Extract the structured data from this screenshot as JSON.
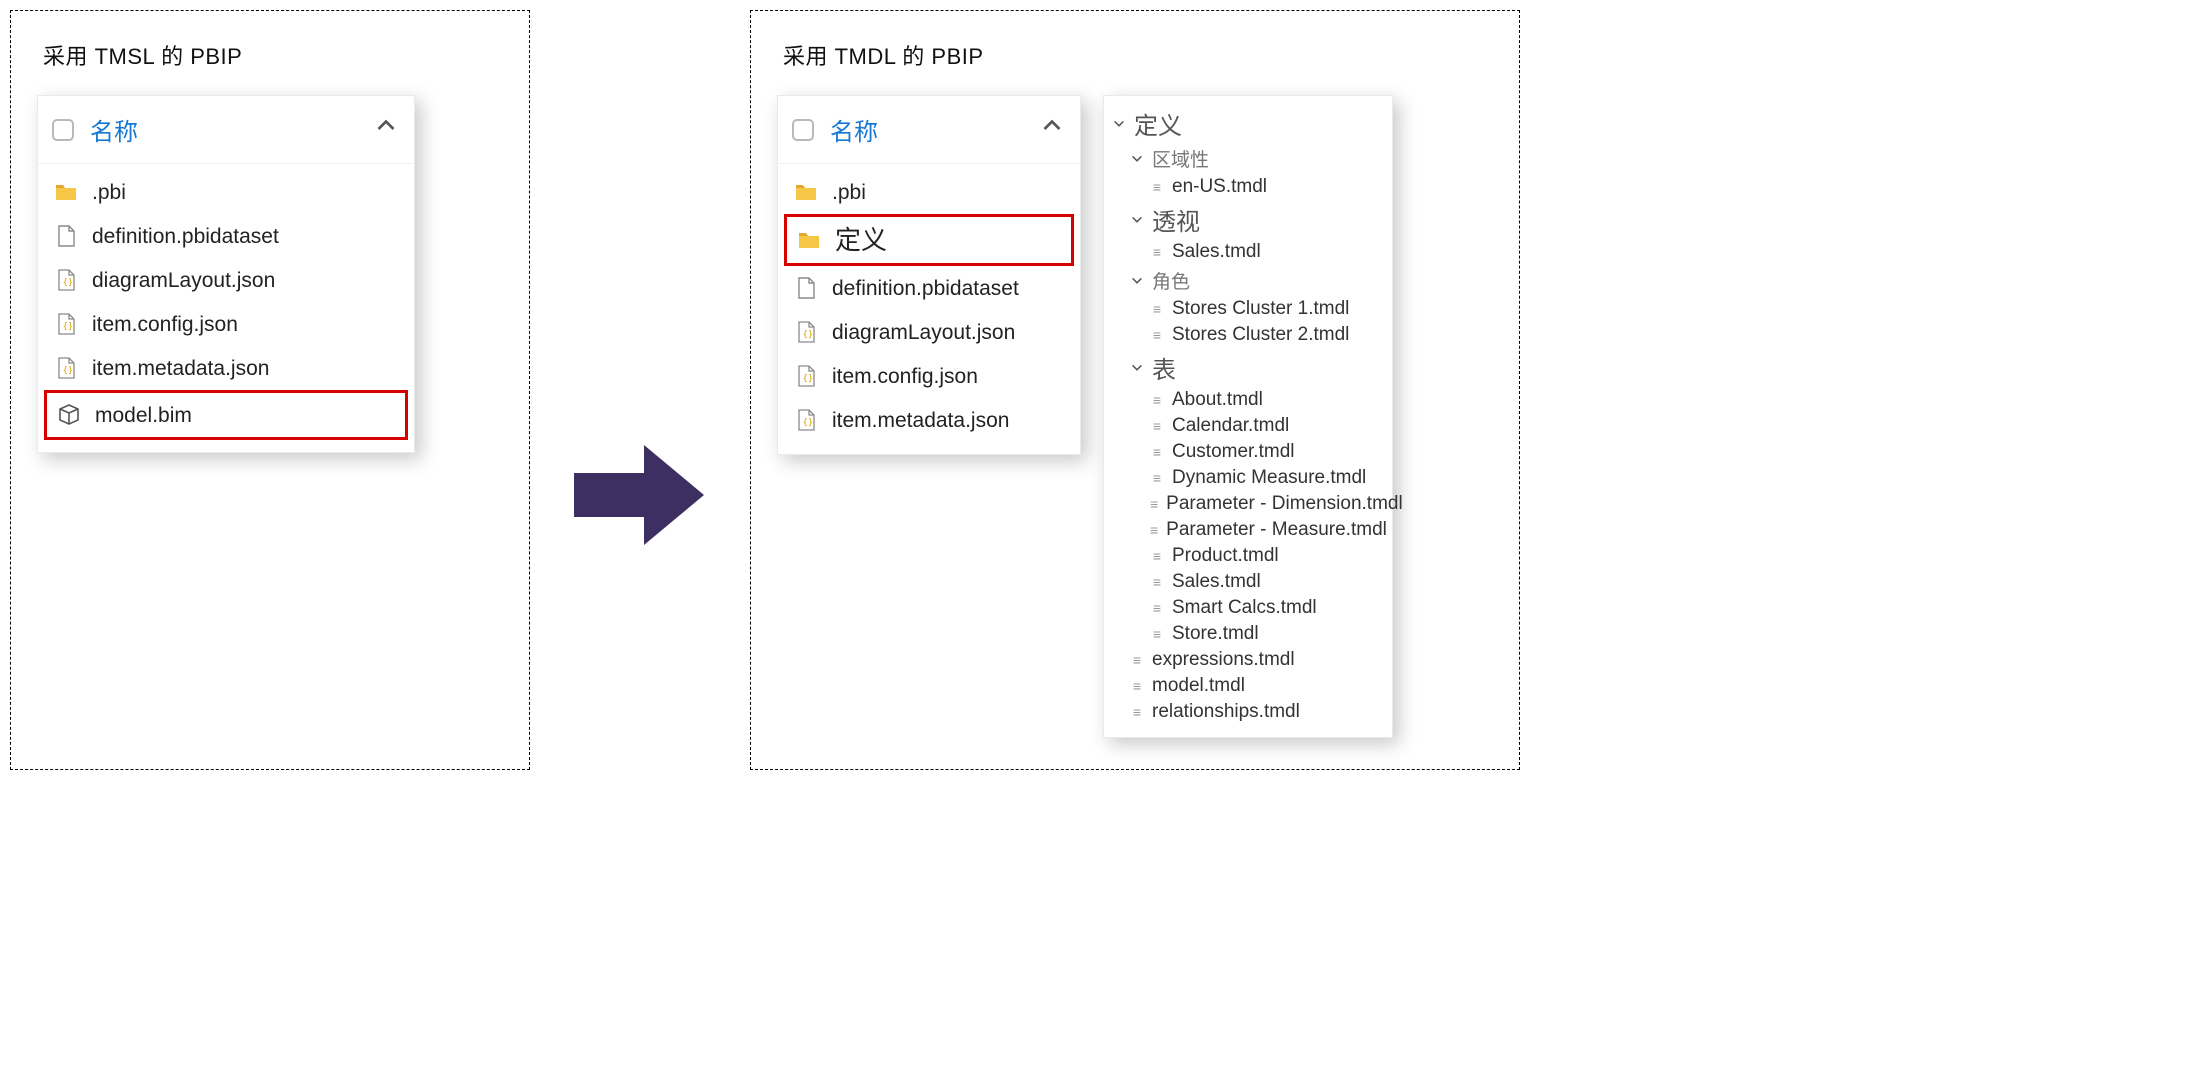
{
  "left": {
    "title": "采用 TMSL 的 PBIP",
    "name_header": "名称",
    "files": [
      {
        "kind": "folder",
        "label": ".pbi"
      },
      {
        "kind": "file",
        "label": "definition.pbidataset"
      },
      {
        "kind": "json",
        "label": "diagramLayout.json"
      },
      {
        "kind": "json",
        "label": "item.config.json"
      },
      {
        "kind": "json",
        "label": "item.metadata.json"
      },
      {
        "kind": "model",
        "label": "model.bim",
        "highlight": true
      }
    ]
  },
  "right": {
    "title": "采用 TMDL 的 PBIP",
    "name_header": "名称",
    "files": [
      {
        "kind": "folder",
        "label": ".pbi"
      },
      {
        "kind": "folder",
        "label": "定义",
        "big": true,
        "highlight": true
      },
      {
        "kind": "file",
        "label": "definition.pbidataset"
      },
      {
        "kind": "json",
        "label": "diagramLayout.json"
      },
      {
        "kind": "json",
        "label": "item.config.json"
      },
      {
        "kind": "json",
        "label": "item.metadata.json"
      }
    ],
    "tree": {
      "root": "定义",
      "groups": [
        {
          "label": "区域性",
          "size": "sm",
          "items": [
            "en-US.tmdl"
          ]
        },
        {
          "label": "透视",
          "size": "lg",
          "items": [
            "Sales.tmdl"
          ]
        },
        {
          "label": "角色",
          "size": "sm",
          "items": [
            "Stores Cluster 1.tmdl",
            "Stores Cluster 2.tmdl"
          ]
        },
        {
          "label": "表",
          "size": "lg",
          "items": [
            "About.tmdl",
            "Calendar.tmdl",
            "Customer.tmdl",
            "Dynamic Measure.tmdl",
            "Parameter - Dimension.tmdl",
            "Parameter - Measure.tmdl",
            "Product.tmdl",
            "Sales.tmdl",
            "Smart Calcs.tmdl",
            "Store.tmdl"
          ]
        }
      ],
      "tail": [
        "expressions.tmdl",
        "model.tmdl",
        "relationships.tmdl"
      ]
    }
  }
}
